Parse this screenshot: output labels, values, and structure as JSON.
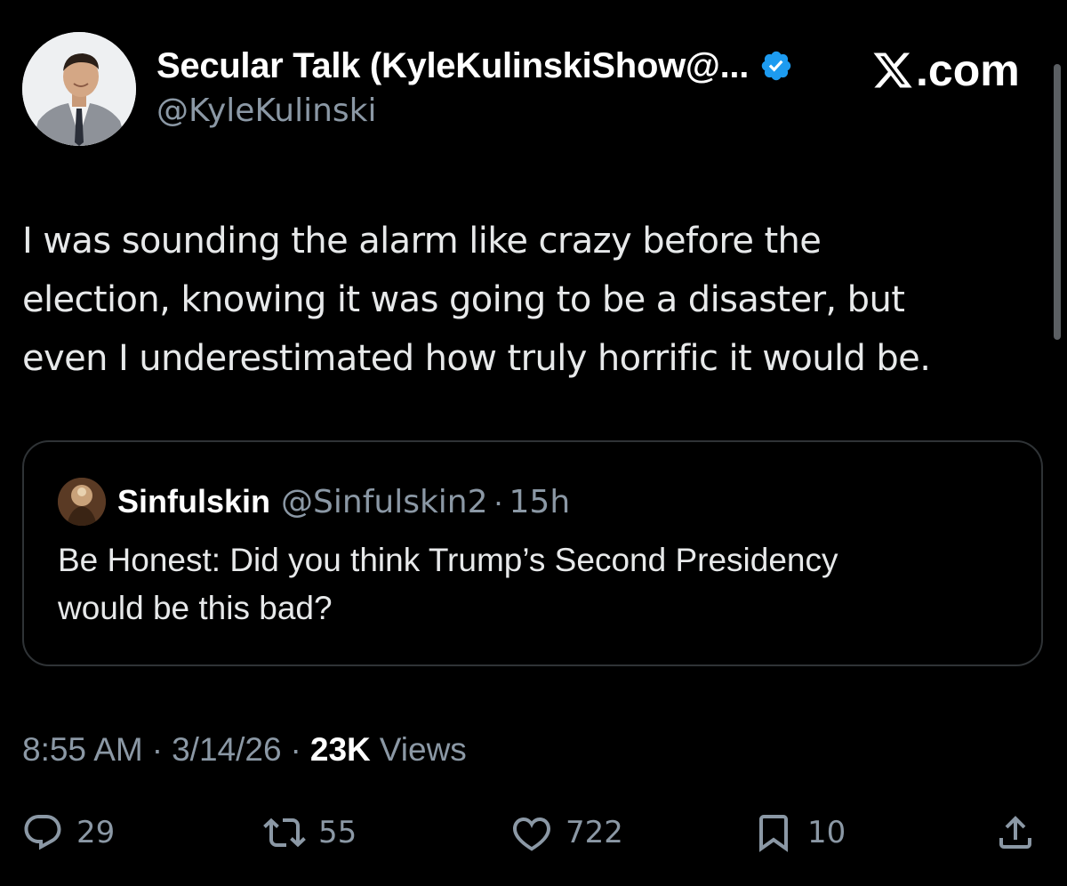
{
  "author": {
    "name": "Secular Talk (KyleKulinskiShow@...",
    "handle": "@KyleKulinski",
    "verified": true
  },
  "brand": {
    "label": ".com"
  },
  "tweet": {
    "lines": [
      "I was sounding the alarm like crazy before the",
      "election, knowing it was going to be a disaster, but",
      "even I underestimated how truly horrific it would be."
    ]
  },
  "quote": {
    "name": "Sinfulskin",
    "handle": "@Sinfulskin2",
    "separator": "·",
    "time": "15h",
    "lines": [
      "Be Honest: Did you think Trump’s Second Presidency",
      "would be this bad?"
    ]
  },
  "meta": {
    "time": "8:55 AM",
    "separator": "·",
    "date": "3/14/26",
    "views_count": "23K",
    "views_label": "Views"
  },
  "actions": {
    "replies": "29",
    "reposts": "55",
    "likes": "722",
    "bookmarks": "10"
  },
  "colors": {
    "background": "#000000",
    "text": "#e7e9ea",
    "secondary": "#8b98a5",
    "verified": "#1d9bf0",
    "border": "#2f3336"
  }
}
